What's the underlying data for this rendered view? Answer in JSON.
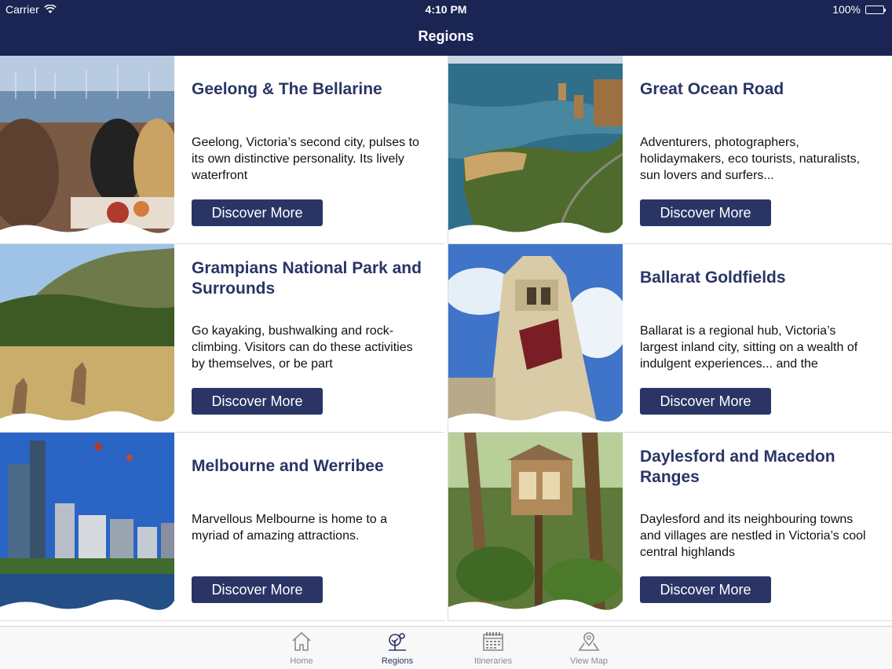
{
  "status": {
    "carrier": "Carrier",
    "time": "4:10 PM",
    "battery": "100%"
  },
  "nav": {
    "title": "Regions"
  },
  "regions": [
    {
      "title": "Geelong & The Bellarine",
      "desc": "Geelong, Victoria’s second city, pulses to its own distinctive personality. Its lively waterfront",
      "button": "Discover More"
    },
    {
      "title": "Great Ocean Road",
      "desc": "Adventurers, photographers, holidaymakers, eco tourists, naturalists, sun lovers and surfers...",
      "button": "Discover More"
    },
    {
      "title": "Grampians National Park and Surrounds",
      "desc": "Go kayaking, bushwalking and rock-climbing. Visitors can do these activities by themselves, or be part",
      "button": "Discover More"
    },
    {
      "title": "Ballarat Goldfields",
      "desc": "Ballarat is a regional hub, Victoria’s largest inland city, sitting on a wealth of indulgent experiences... and the",
      "button": "Discover More"
    },
    {
      "title": "Melbourne and Werribee",
      "desc": "Marvellous Melbourne is home to a myriad of amazing attractions.",
      "button": "Discover More"
    },
    {
      "title": "Daylesford and Macedon Ranges",
      "desc": "Daylesford and its neighbouring towns and villages are nestled in Victoria’s cool central highlands",
      "button": "Discover More"
    }
  ],
  "tabs": [
    {
      "label": "Home",
      "icon": "home-icon"
    },
    {
      "label": "Regions",
      "icon": "tree-icon"
    },
    {
      "label": "Itineraries",
      "icon": "calendar-icon"
    },
    {
      "label": "View Map",
      "icon": "map-pin-icon"
    }
  ],
  "colors": {
    "nav": "#1b2553",
    "accent": "#2a3566",
    "tab_inactive": "#8a8a8a"
  }
}
